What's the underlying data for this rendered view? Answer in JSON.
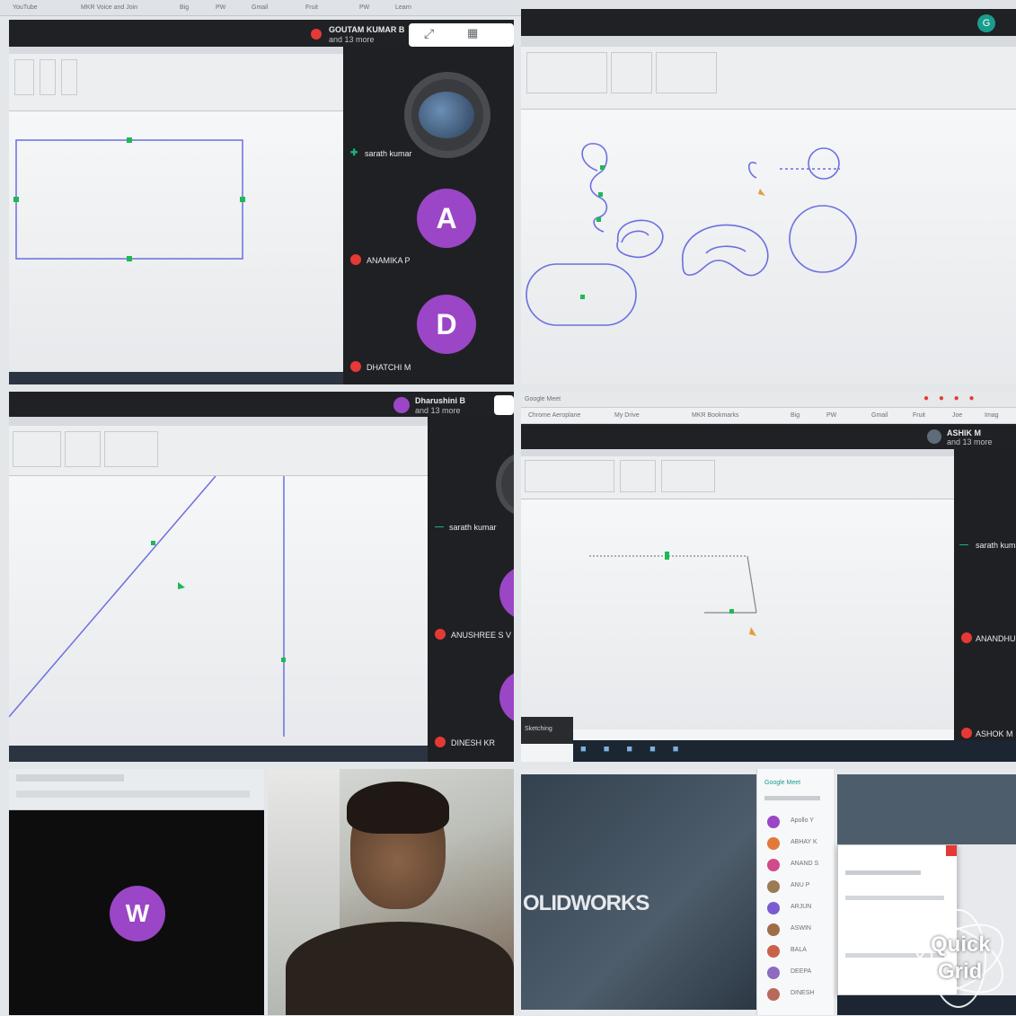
{
  "browser": {
    "tabs": [
      "YouTube",
      "MKR Voice and Join",
      "Big",
      "PW",
      "Gmail",
      "Fruit",
      "PW",
      "Learn"
    ],
    "url": "Google Meet"
  },
  "tiles": {
    "tile1": {
      "presenter_label": "GOUTAM KUMAR B",
      "presenter_sub": "and 13 more",
      "participants": [
        {
          "name": "sarath kumar",
          "initial": ""
        },
        {
          "name": "ANAMIKA P",
          "initial": "A"
        },
        {
          "name": "DHATCHI M",
          "initial": "D"
        }
      ]
    },
    "tile2": {
      "presenter_initial": "G"
    },
    "tile3": {
      "presenter_label": "Dharushini B",
      "presenter_sub": "and 13 more",
      "participants": [
        {
          "name": "sarath kumar"
        },
        {
          "name": "ANUSHREE S V"
        },
        {
          "name": "DINESH KR"
        }
      ]
    },
    "tile4": {
      "window_title": "Google Meet",
      "bookmarks": [
        "Chrome Aeroplane",
        "My Drive",
        "MKR Bookmarks",
        "Big",
        "PW",
        "Gmail",
        "Fruit",
        "Joe",
        "Imag"
      ],
      "presenter_label": "ASHIK M",
      "presenter_sub": "and 13 more",
      "participants": [
        {
          "name": "sarath kumar"
        },
        {
          "name": "ANANDHU J"
        },
        {
          "name": "ASHOK M"
        }
      ],
      "panel_label": "Sketching"
    },
    "tile5": {
      "participant_initial": "W"
    },
    "tile7": {
      "splash_text": "OLIDWORKS",
      "chat_title": "Google Meet",
      "chat_people": [
        "Apollo Y",
        "ABHAY K",
        "ANAND S",
        "ANU P",
        "ARJUN",
        "ASWIN",
        "BALA",
        "DEEPA",
        "DINESH"
      ]
    }
  },
  "watermark": {
    "line1": "Quick",
    "line2": "Grid"
  },
  "colors": {
    "meet_dark": "#202124",
    "avatar_purple": "#9b46c6",
    "sketch_blue": "#5b5fd6",
    "mic_red": "#e53935"
  }
}
